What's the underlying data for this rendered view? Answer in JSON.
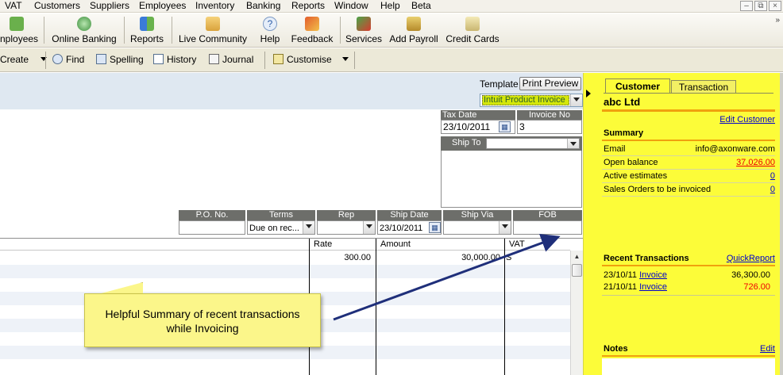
{
  "menu": [
    "VAT",
    "Customers",
    "Suppliers",
    "Employees",
    "Inventory",
    "Banking",
    "Reports",
    "Window",
    "Help",
    "Beta"
  ],
  "window_controls": [
    "–",
    "⧉",
    "×"
  ],
  "iconbar": {
    "items": [
      "nployees",
      "Online Banking",
      "Reports",
      "Live Community",
      "Help",
      "Feedback",
      "Services",
      "Add Payroll",
      "Credit Cards"
    ],
    "overflow": "»"
  },
  "toolbar": {
    "create": "Create",
    "find": "Find",
    "spelling": "Spelling",
    "history": "History",
    "journal": "Journal",
    "customise": "Customise"
  },
  "template": {
    "label": "Template",
    "print_preview": "Print Preview",
    "selected": "Intuit Product Invoice"
  },
  "header_fields": {
    "tax_date_label": "Tax Date",
    "tax_date": "23/10/2011",
    "invoice_no_label": "Invoice No",
    "invoice_no": "3",
    "ship_to_label": "Ship To"
  },
  "order_fields": {
    "po_label": "P.O. No.",
    "terms_label": "Terms",
    "terms": "Due on rec...",
    "rep_label": "Rep",
    "ship_date_label": "Ship Date",
    "ship_date": "23/10/2011",
    "ship_via_label": "Ship Via",
    "fob_label": "FOB"
  },
  "lines": {
    "headers": {
      "rate": "Rate",
      "amount": "Amount",
      "vat": "VAT"
    },
    "rows": [
      {
        "rate": "300.00",
        "amount": "30,000.00",
        "vat": "S"
      }
    ]
  },
  "callout": {
    "line1": "Helpful Summary of recent transactions",
    "line2": "while Invoicing"
  },
  "pane": {
    "tabs": [
      "Customer",
      "Transaction"
    ],
    "customer_name": "abc Ltd",
    "edit_customer": "Edit Customer",
    "summary_title": "Summary",
    "summary": [
      {
        "label": "Email",
        "value": "info@axonware.com",
        "link": false,
        "red": false
      },
      {
        "label": "Open balance",
        "value": "37,026.00",
        "link": true,
        "red": true
      },
      {
        "label": "Active estimates",
        "value": "0",
        "link": true,
        "red": false
      },
      {
        "label": "Sales Orders to be invoiced",
        "value": "0",
        "link": true,
        "red": false
      }
    ],
    "recent_title": "Recent Transactions",
    "quick_report": "QuickReport",
    "recent": [
      {
        "date": "23/10/11",
        "type": "Invoice",
        "amount": "36,300.00",
        "red": false
      },
      {
        "date": "21/10/11",
        "type": "Invoice",
        "amount": "726.00",
        "red": true
      }
    ],
    "notes_title": "Notes",
    "notes_edit": "Edit"
  },
  "colors": {
    "pane_bg": "#fcfc39",
    "accent_orange": "#f0a10d",
    "callout_bg": "#fbf68a",
    "arrow": "#1f2f7a",
    "header_gray": "#6d6e6a"
  }
}
